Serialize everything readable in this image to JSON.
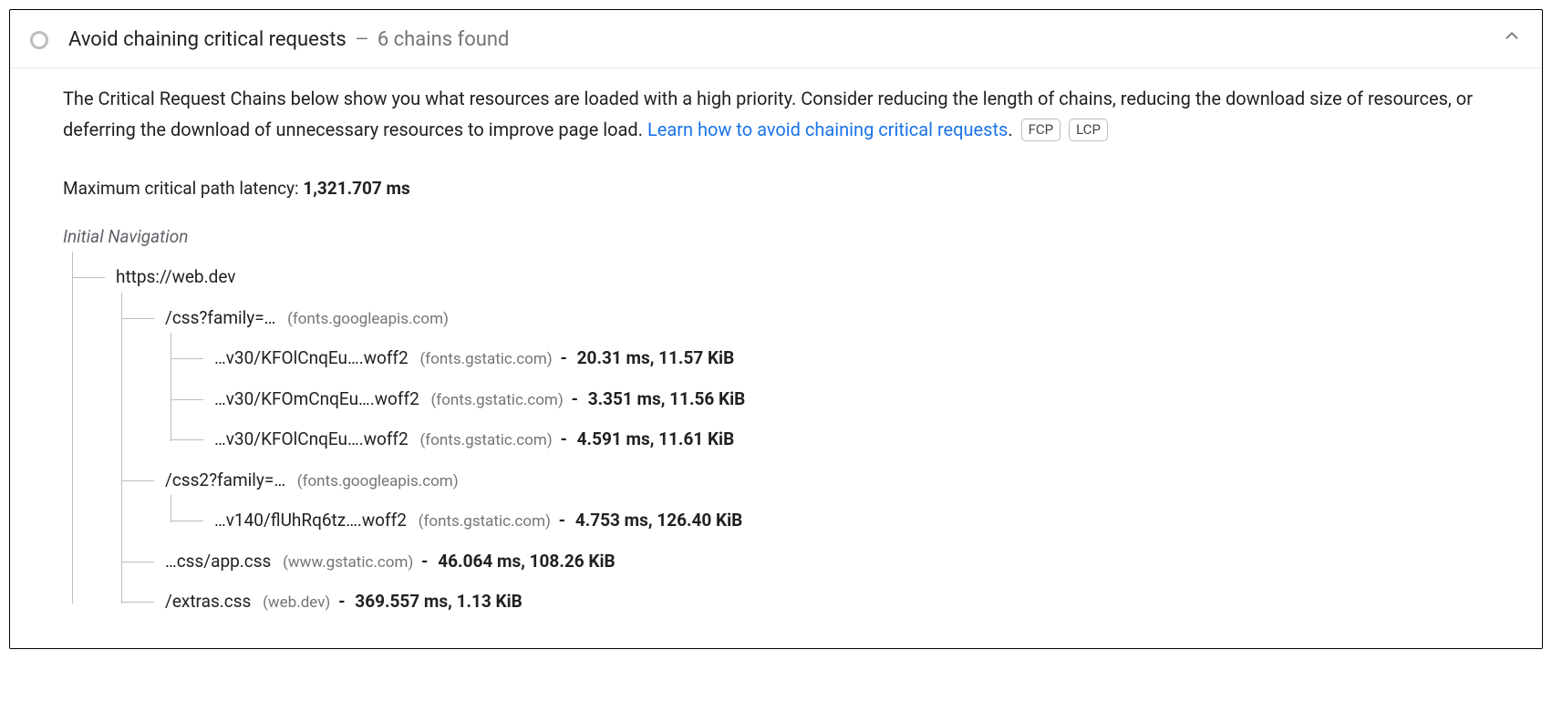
{
  "header": {
    "title": "Avoid chaining critical requests",
    "separator": "—",
    "suffix": "6 chains found"
  },
  "description": {
    "text_before_link": "The Critical Request Chains below show you what resources are loaded with a high priority. Consider reducing the length of chains, reducing the download size of resources, or deferring the download of unnecessary resources to improve page load. ",
    "link_text": "Learn how to avoid chaining critical requests",
    "text_after_link": "."
  },
  "badges": [
    "FCP",
    "LCP"
  ],
  "latency": {
    "label": "Maximum critical path latency: ",
    "value": "1,321.707 ms"
  },
  "tree": {
    "root_label": "Initial Navigation",
    "root_url": "https://web.dev",
    "nodes": [
      {
        "path": "/css?family=…",
        "host": "(fonts.googleapis.com)",
        "children": [
          {
            "path": "…v30/KFOlCnqEu….woff2",
            "host": "(fonts.gstatic.com)",
            "time": "20.31 ms",
            "size": "11.57 KiB"
          },
          {
            "path": "…v30/KFOmCnqEu….woff2",
            "host": "(fonts.gstatic.com)",
            "time": "3.351 ms",
            "size": "11.56 KiB"
          },
          {
            "path": "…v30/KFOlCnqEu….woff2",
            "host": "(fonts.gstatic.com)",
            "time": "4.591 ms",
            "size": "11.61 KiB"
          }
        ]
      },
      {
        "path": "/css2?family=…",
        "host": "(fonts.googleapis.com)",
        "children": [
          {
            "path": "…v140/flUhRq6tz….woff2",
            "host": "(fonts.gstatic.com)",
            "time": "4.753 ms",
            "size": "126.40 KiB"
          }
        ]
      },
      {
        "path": "…css/app.css",
        "host": "(www.gstatic.com)",
        "time": "46.064 ms",
        "size": "108.26 KiB"
      },
      {
        "path": "/extras.css",
        "host": "(web.dev)",
        "time": "369.557 ms",
        "size": "1.13 KiB"
      }
    ]
  }
}
